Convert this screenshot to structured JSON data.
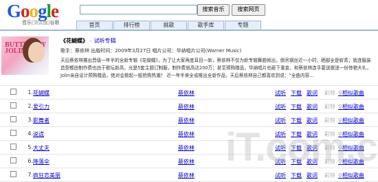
{
  "header": {
    "logo_text": "Google",
    "logo_sub": "音乐",
    "logo_beta": "[测试版]",
    "logo_sub2": "谷歌",
    "search_value": "",
    "btn_music": "搜索音乐",
    "btn_web": "搜索网页"
  },
  "tabs": [
    "首页",
    "排行榜",
    "挑歌",
    "歌手库",
    "专题"
  ],
  "album": {
    "title": "《花蝴蝶》",
    "dot": "-",
    "listen_link": "试听专辑",
    "meta": "歌手：蔡依林    出版时间：2009年3月27日    唱片公司：华纳唱片公司(Warner Music)",
    "desc": "天后蔡依林推出晋级一年半的全新专辑《花蝴蝶》，为了让大家再度耳目一新，蔡依林不仅为新专辑舞曲倾出，倒吊钢丝近一小时，晒部全是崭青；就连服装造型都由制作费也由于歌坛新高，光是5套主题订制服，制作费就高达200万；甚至预购赠品，华纳唱片也砸下重金，和蔡依林连手要送歌迷一份惊艳大礼，Jolin亲自设计预购赠品，绝对会掀起一股抢购热潮！                   近一年半来全省推出全新作品，天后蔡依林自己都喜欢到说：“全曲内容…",
    "desc_more": "全曲内容»",
    "cover_text": "BUTTERFLY JOLIN"
  },
  "songs": [
    {
      "num": "1.",
      "title": "花蝴蝶",
      "artist": "蔡依林"
    },
    {
      "num": "2.",
      "title": "爱引力",
      "artist": "蔡依林"
    },
    {
      "num": "3.",
      "title": "影舞者",
      "artist": "蔡依林"
    },
    {
      "num": "4.",
      "title": "说谎",
      "artist": "蔡依林"
    },
    {
      "num": "5.",
      "title": "大丈夫",
      "artist": "蔡依林"
    },
    {
      "num": "6.",
      "title": "降落伞",
      "artist": "蔡依林"
    },
    {
      "num": "7.",
      "title": "疯狂恋美丽",
      "artist": "蔡依林"
    }
  ],
  "song_actions": {
    "listen": "试听",
    "download": "下载",
    "lyrics": "歌词",
    "ringtone": "彩铃",
    "similar": "相似歌曲"
  },
  "watermark": "iT.com.cn"
}
